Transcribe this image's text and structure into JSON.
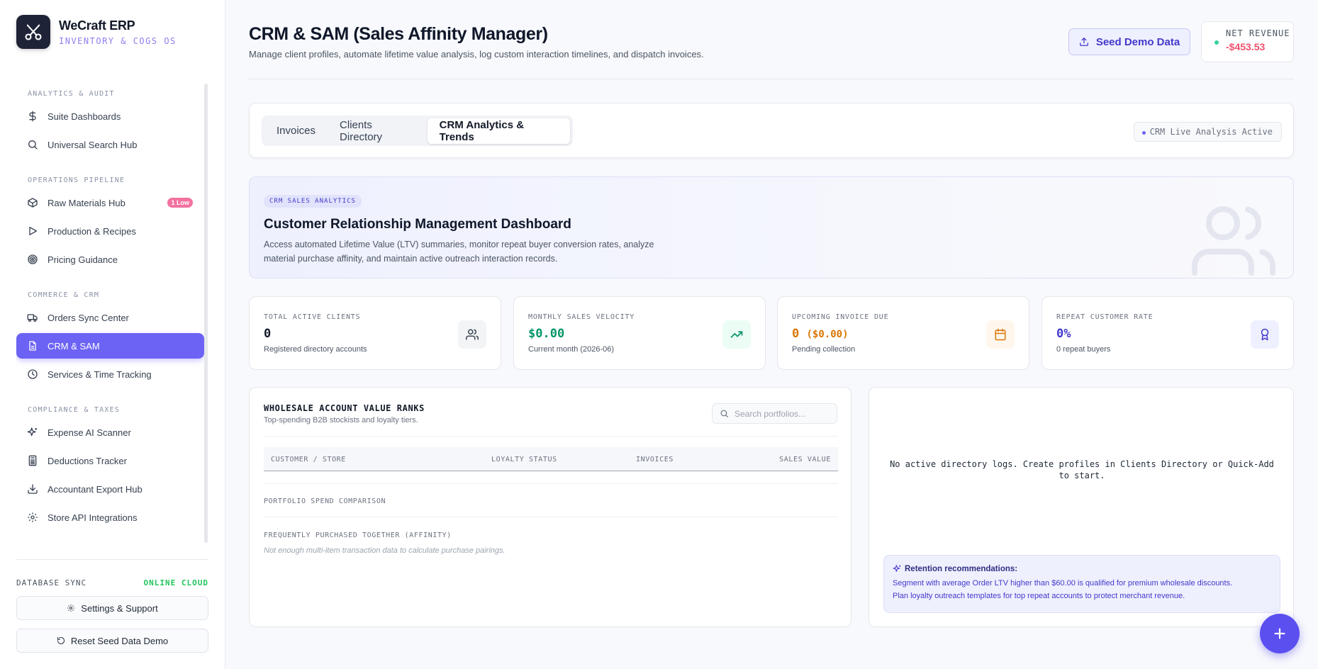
{
  "brand": {
    "name": "WeCraft ERP",
    "subtitle": "INVENTORY & COGS OS"
  },
  "sidebar": {
    "sections": [
      {
        "title": "ANALYTICS & AUDIT",
        "items": [
          {
            "label": "Suite Dashboards",
            "icon": "dollar-icon"
          },
          {
            "label": "Universal Search Hub",
            "icon": "search-icon"
          }
        ]
      },
      {
        "title": "OPERATIONS PIPELINE",
        "items": [
          {
            "label": "Raw Materials Hub",
            "icon": "box-icon",
            "badge": "1 Low"
          },
          {
            "label": "Production & Recipes",
            "icon": "play-icon"
          },
          {
            "label": "Pricing Guidance",
            "icon": "target-icon"
          }
        ]
      },
      {
        "title": "COMMERCE & CRM",
        "items": [
          {
            "label": "Orders Sync Center",
            "icon": "truck-icon"
          },
          {
            "label": "CRM & SAM",
            "icon": "file-icon",
            "active": true
          },
          {
            "label": "Services & Time Tracking",
            "icon": "clock-icon"
          }
        ]
      },
      {
        "title": "COMPLIANCE & TAXES",
        "items": [
          {
            "label": "Expense AI Scanner",
            "icon": "sparkle-icon"
          },
          {
            "label": "Deductions Tracker",
            "icon": "calculator-icon"
          },
          {
            "label": "Accountant Export Hub",
            "icon": "download-icon"
          },
          {
            "label": "Store API Integrations",
            "icon": "gear-icon"
          }
        ]
      }
    ],
    "db_sync_label": "DATABASE SYNC",
    "db_sync_status": "ONLINE CLOUD",
    "settings_label": "Settings & Support",
    "reset_label": "Reset Seed Data Demo"
  },
  "header": {
    "title": "CRM & SAM (Sales Affinity Manager)",
    "description": "Manage client profiles, automate lifetime value analysis, log custom interaction timelines, and dispatch invoices.",
    "seed_label": "Seed Demo Data",
    "revenue_label": "NET REVENUE",
    "revenue_value": "-$453.53"
  },
  "tabs": {
    "items": [
      "Invoices",
      "Clients Directory",
      "CRM Analytics & Trends"
    ],
    "active": 2,
    "live_status": "CRM Live Analysis Active"
  },
  "hero": {
    "tag": "CRM SALES ANALYTICS",
    "title": "Customer Relationship Management Dashboard",
    "description": "Access automated Lifetime Value (LTV) summaries, monitor repeat buyer conversion rates, analyze material purchase affinity, and maintain active outreach interaction records."
  },
  "stats": [
    {
      "label": "TOTAL ACTIVE CLIENTS",
      "value": "0",
      "sub": "Registered directory accounts",
      "icon": "users-icon",
      "color": "#111827",
      "bg": "#f3f4f6",
      "stroke": "#374151"
    },
    {
      "label": "MONTHLY SALES VELOCITY",
      "value": "$0.00",
      "sub": "Current month (2026-06)",
      "icon": "trending-up-icon",
      "color": "#059669",
      "bg": "#ecfdf5",
      "stroke": "#059669"
    },
    {
      "label": "UPCOMING INVOICE DUE",
      "value": "0",
      "value_extra": "($0.00)",
      "sub": "Pending collection",
      "icon": "calendar-icon",
      "color": "#d97706",
      "bg": "#fff7ed",
      "stroke": "#d97706"
    },
    {
      "label": "REPEAT CUSTOMER RATE",
      "value": "0%",
      "sub": "0 repeat buyers",
      "icon": "award-icon",
      "color": "#4338ca",
      "bg": "#eef0ff",
      "stroke": "#4338ca"
    }
  ],
  "ranks": {
    "title": "WHOLESALE ACCOUNT VALUE RANKS",
    "subtitle": "Top-spending B2B stockists and loyalty tiers.",
    "search_placeholder": "Search portfolios...",
    "columns": [
      "CUSTOMER / STORE",
      "LOYALTY STATUS",
      "INVOICES",
      "SALES VALUE"
    ],
    "spend_label": "PORTFOLIO SPEND COMPARISON",
    "affinity_label": "FREQUENTLY PURCHASED TOGETHER (AFFINITY)",
    "affinity_empty": "Not enough multi-item transaction data to calculate purchase pairings."
  },
  "logs": {
    "empty": "No active directory logs. Create profiles in Clients Directory or Quick-Add to start.",
    "retention_title": "Retention recommendations:",
    "retention_line1": "Segment with average Order LTV higher than $60.00 is qualified for premium wholesale discounts.",
    "retention_line2": "Plan loyalty outreach templates for top repeat accounts to protect merchant revenue."
  }
}
